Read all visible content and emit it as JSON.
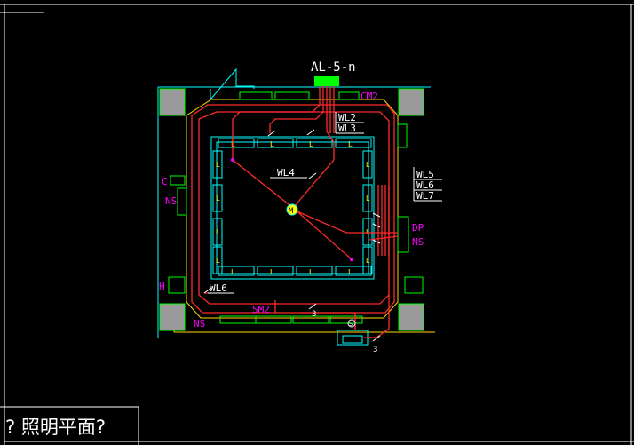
{
  "panel": {
    "label": "AL-5-n"
  },
  "circuits": [
    "WL2",
    "WL3",
    "WL4",
    "WL5",
    "WL6",
    "WL7",
    "WL6"
  ],
  "tags": {
    "cm2": "CM2",
    "c": "C",
    "ns_left": "NS",
    "ns_right": "NS",
    "ns_bottom": "NS",
    "dp": "DP",
    "h": "H",
    "sm2": "SM2",
    "center_fixture": "M",
    "bottom_fixture": "S",
    "count_a": "3",
    "count_b": "3"
  },
  "fixture_letter": "L",
  "title_block": {
    "text": "? 照明平面?"
  },
  "colors": {
    "background": "#000000",
    "wire": "#ff2a2a",
    "wall": "#00ffff",
    "outline": "#ffd700",
    "equipment": "#00ff00",
    "label": "#ffffff",
    "tag": "#ff00ff",
    "column": "#9a9a9a",
    "fixture": "#ffff00"
  }
}
